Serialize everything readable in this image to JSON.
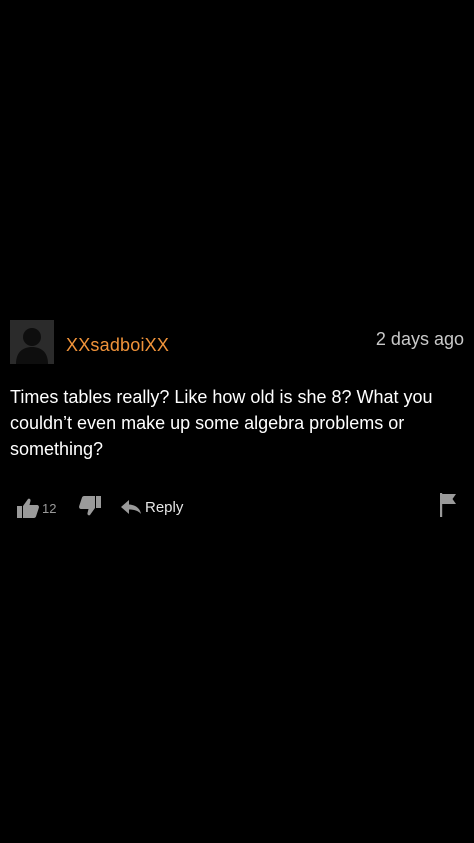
{
  "comment": {
    "username": "XXsadboiXX",
    "timestamp": "2 days ago",
    "text": "Times tables really? Like how old is she 8? What you couldn’t even make up some algebra problems or something?",
    "likes": "12",
    "reply_label": "Reply"
  },
  "colors": {
    "background": "#000000",
    "username": "#f0933a",
    "timestamp": "#c9c9c9",
    "body_text": "#ffffff",
    "icon": "#9a9a9a"
  },
  "icons": {
    "avatar": "default-user-silhouette",
    "like": "thumbs-up-icon",
    "dislike": "thumbs-down-icon",
    "reply": "reply-arrow-icon",
    "flag": "flag-icon"
  }
}
